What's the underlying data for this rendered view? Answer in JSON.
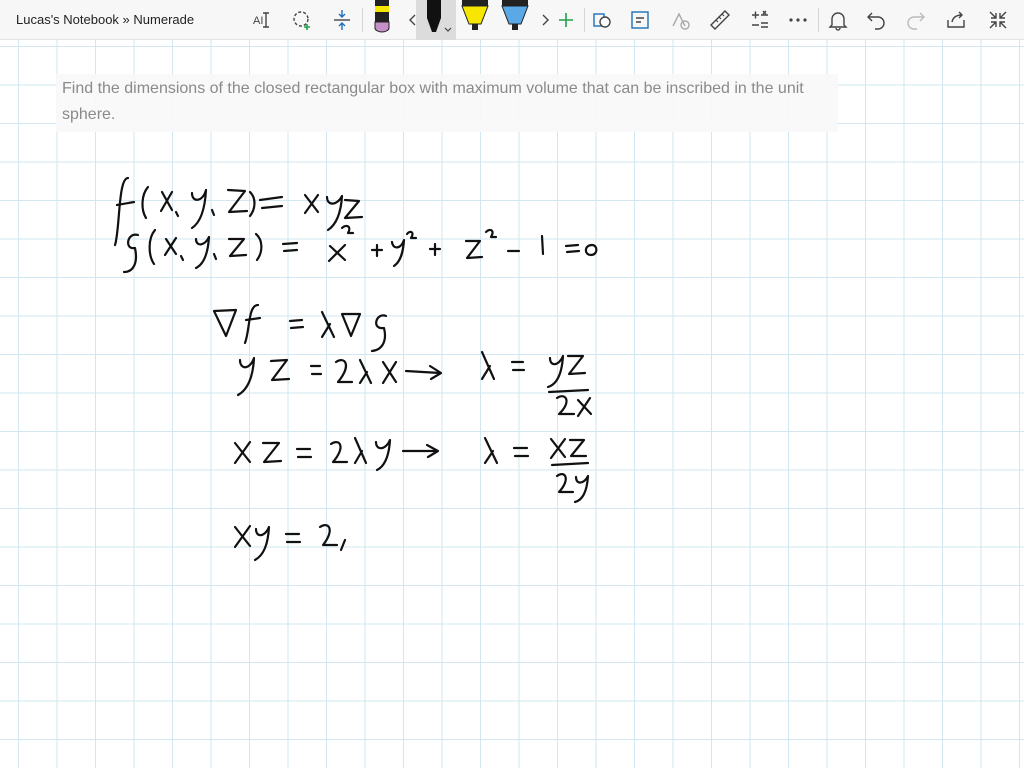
{
  "window": {
    "breadcrumb": "Lucas's Notebook » Numerade"
  },
  "toolbar": {
    "tools": [
      {
        "name": "math-text-icon"
      },
      {
        "name": "lasso-select-icon"
      },
      {
        "name": "add-space-icon"
      },
      {
        "name": "pen-purple"
      },
      {
        "name": "pen-black-selected"
      },
      {
        "name": "highlighter-yellow"
      },
      {
        "name": "highlighter-blue"
      },
      {
        "name": "add-pen-icon"
      },
      {
        "name": "ink-to-shape-icon"
      },
      {
        "name": "ink-to-text-icon"
      },
      {
        "name": "ink-to-math-icon"
      },
      {
        "name": "ruler-icon"
      },
      {
        "name": "math-icon"
      },
      {
        "name": "more-icon"
      },
      {
        "name": "bell-icon"
      },
      {
        "name": "undo-icon"
      },
      {
        "name": "redo-icon"
      },
      {
        "name": "share-icon"
      },
      {
        "name": "collapse-icon"
      }
    ],
    "colors": {
      "pen_purple_tip": "#c58fc7",
      "pen_black": "#000000",
      "highlighter_yellow": "#f6e600",
      "highlighter_blue": "#5aa9e6",
      "accent_green": "#21a04a",
      "accent_blue": "#1e6fb8"
    }
  },
  "page": {
    "question": "Find the dimensions of the closed rectangular box with maximum volume that can be inscribed in the unit sphere."
  }
}
